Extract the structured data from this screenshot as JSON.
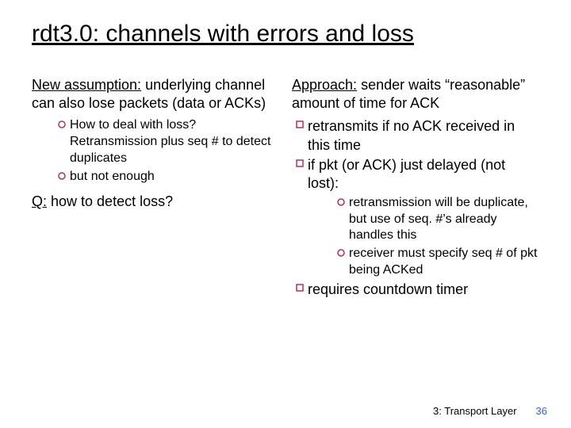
{
  "title": "rdt3.0: channels with errors and loss",
  "left": {
    "assumption_label": "New assumption:",
    "assumption_body": " underlying channel can also lose packets (data or ACKs)",
    "sub": [
      "How to deal with loss? Retransmission plus seq # to detect duplicates",
      "but not enough"
    ],
    "q_label": "Q:",
    "q_body": " how to detect loss?"
  },
  "right": {
    "approach_label": "Approach:",
    "approach_body": " sender waits “reasonable” amount of time for ACK",
    "bul1": "retransmits if no ACK received in this time",
    "bul2": "if pkt (or ACK) just delayed (not lost):",
    "sub": [
      "retransmission will be duplicate, but use of seq. #’s already handles this",
      "receiver must specify seq # of pkt being ACKed"
    ],
    "bul3": "requires countdown timer"
  },
  "footer": {
    "section": "3: Transport Layer",
    "page": "36"
  }
}
